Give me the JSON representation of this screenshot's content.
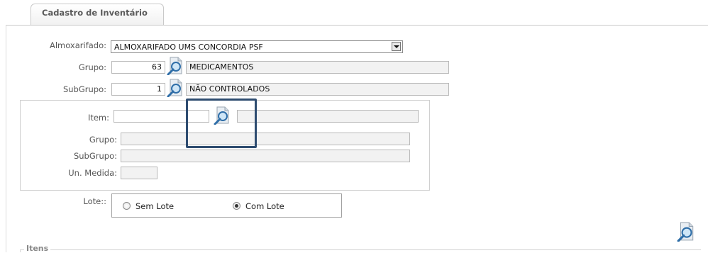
{
  "tab": {
    "label": "Cadastro de Inventário"
  },
  "form": {
    "almoxarifado": {
      "label": "Almoxarifado:",
      "value": "ALMOXARIFADO UMS CONCORDIA PSF"
    },
    "grupo": {
      "label": "Grupo:",
      "code": "63",
      "description": "MEDICAMENTOS"
    },
    "subgrupo": {
      "label": "SubGrupo:",
      "code": "1",
      "description": "NÃO CONTROLADOS"
    }
  },
  "item_panel": {
    "item": {
      "label": "Item:",
      "code": "",
      "description": ""
    },
    "grupo": {
      "label": "Grupo:",
      "value": ""
    },
    "subgrupo": {
      "label": "SubGrupo:",
      "value": ""
    },
    "un_medida": {
      "label": "Un. Medida:",
      "value": ""
    }
  },
  "lote": {
    "label": "Lote::",
    "options": [
      {
        "label": "Sem Lote",
        "selected": false
      },
      {
        "label": "Com Lote",
        "selected": true
      }
    ]
  },
  "itens_section": {
    "legend": "Itens"
  },
  "icons": {
    "lookup": "search-document-icon"
  },
  "colors": {
    "highlight": "#2e4c70",
    "readonly_bg": "#f2f2f2"
  }
}
